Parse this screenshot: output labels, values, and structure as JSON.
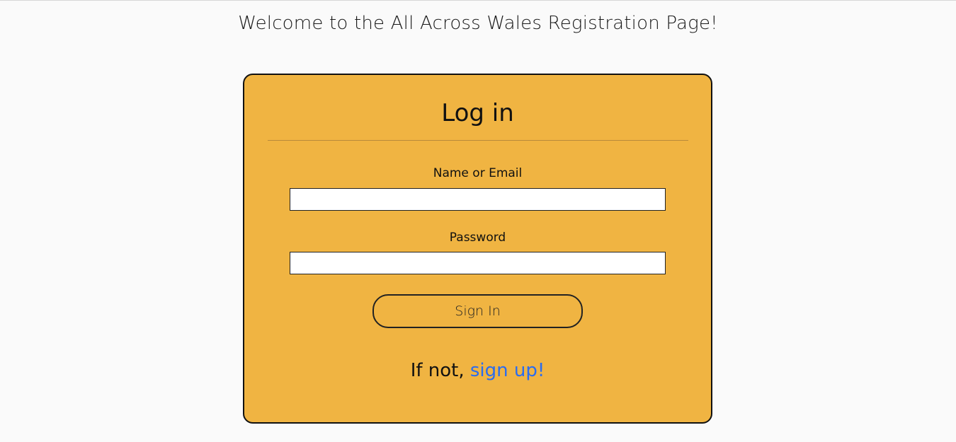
{
  "page": {
    "welcome_text": "Welcome to the All Across Wales Registration Page!"
  },
  "login_card": {
    "title": "Log in",
    "name_label": "Name or Email",
    "name_value": "",
    "name_placeholder": "",
    "password_label": "Password",
    "password_value": "",
    "password_placeholder": "",
    "sign_in_label": "Sign In",
    "signup_prefix": "If not, ",
    "signup_link_text": "sign up!"
  },
  "colors": {
    "page_background": "#fafafa",
    "card_background": "#f0b442",
    "link": "#2a6cf0"
  }
}
